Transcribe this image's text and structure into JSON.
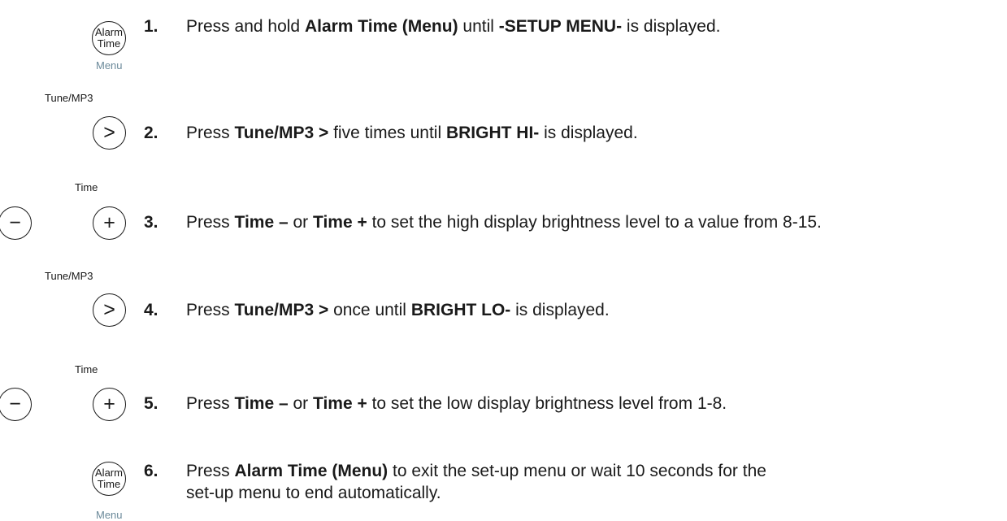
{
  "labels": {
    "alarm_line1": "Alarm",
    "alarm_line2": "Time",
    "menu": "Menu",
    "tune_mp3": "Tune/MP3",
    "time": "Time",
    "next_glyph": ">",
    "minus_glyph": "−",
    "plus_glyph": "+"
  },
  "steps": [
    {
      "num": "1.",
      "parts": [
        "Press and hold ",
        "Alarm Time (Menu)",
        " until ",
        "-SETUP MENU-",
        " is displayed."
      ]
    },
    {
      "num": "2.",
      "parts": [
        "Press ",
        "Tune/MP3 >",
        " five times until ",
        "BRIGHT HI-",
        " is displayed."
      ]
    },
    {
      "num": "3.",
      "parts": [
        "Press ",
        "Time –",
        " or ",
        "Time +",
        " to set the high display brightness level to a value from 8-15."
      ]
    },
    {
      "num": "4.",
      "parts": [
        "Press ",
        "Tune/MP3 >",
        " once until ",
        "BRIGHT LO-",
        " is displayed."
      ]
    },
    {
      "num": "5.",
      "parts": [
        "Press ",
        "Time –",
        " or ",
        "Time +",
        " to set the low display brightness level from 1-8."
      ]
    },
    {
      "num": "6.",
      "parts": [
        "Press ",
        "Alarm Time (Menu)",
        " to exit the set-up menu or wait 10 seconds for the"
      ],
      "line2": "set-up menu to end automatically."
    }
  ],
  "colors": {
    "text": "#1a1a1a",
    "menu_caption": "#6b8a9a"
  }
}
